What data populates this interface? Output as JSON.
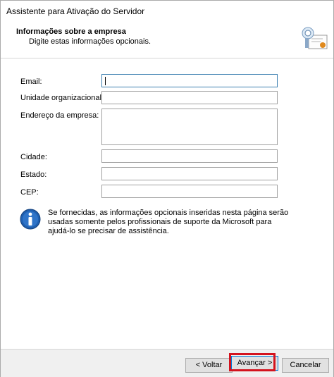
{
  "window": {
    "title": "Assistente para Ativação do Servidor"
  },
  "header": {
    "title": "Informações sobre a empresa",
    "subtitle": "Digite estas informações opcionais."
  },
  "form": {
    "email_label": "Email:",
    "org_unit_label": "Unidade organizacional:",
    "address_label": "Endereço da empresa:",
    "city_label": "Cidade:",
    "state_label": "Estado:",
    "zip_label": "CEP:",
    "email_value": "",
    "org_unit_value": "",
    "address_value": "",
    "city_value": "",
    "state_value": "",
    "zip_value": ""
  },
  "info": {
    "text": "Se fornecidas, as informações opcionais inseridas nesta página serão usadas somente pelos profissionais de suporte da Microsoft para ajudá-lo se precisar de assistência."
  },
  "footer": {
    "back_label": "< Voltar",
    "next_label": "Avançar >",
    "cancel_label": "Cancelar"
  },
  "colors": {
    "highlight": "#d4131e",
    "info_icon": "#1f5fb0",
    "focus_border": "#3c7fb1"
  }
}
